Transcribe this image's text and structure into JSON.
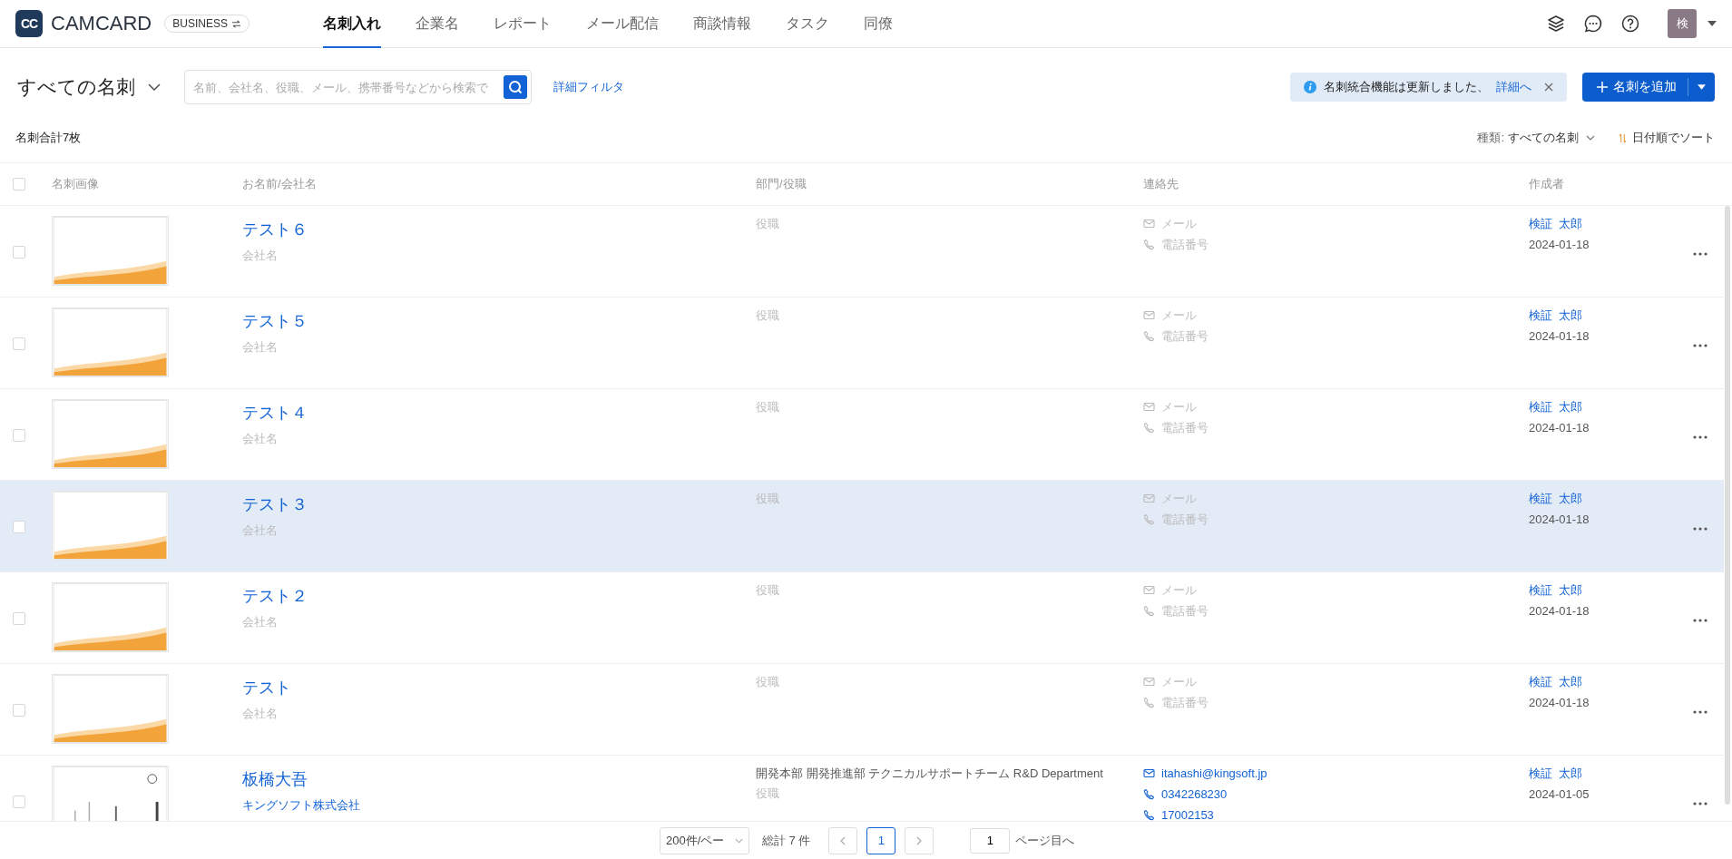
{
  "topbar": {
    "logo_mark": "CC",
    "brand": "CAMCARD",
    "edition": "BUSINESS",
    "nav": [
      {
        "label": "名刺入れ",
        "selected": true
      },
      {
        "label": "企業名",
        "selected": false
      },
      {
        "label": "レポート",
        "selected": false
      },
      {
        "label": "メール配信",
        "selected": false
      },
      {
        "label": "商談情報",
        "selected": false
      },
      {
        "label": "タスク",
        "selected": false
      },
      {
        "label": "同僚",
        "selected": false
      }
    ],
    "avatar": "検"
  },
  "toolbar": {
    "view_title": "すべての名刺",
    "search": {
      "placeholder": "名前、会社名、役職、メール、携帯番号などから検索で"
    },
    "filter_link": "詳細フィルタ",
    "notice": {
      "text": "名刺統合機能は更新しました、",
      "link": "詳細へ"
    },
    "add_button": "名刺を追加"
  },
  "summary": {
    "count": "名刺合計7枚",
    "type_label": "種類:",
    "type_value": "すべての名刺",
    "sort": "日付順でソート"
  },
  "table": {
    "select_all_checked": false,
    "columns": [
      "名刺画像",
      "お名前/会社名",
      "部門/役職",
      "連絡先",
      "作成者"
    ],
    "rows": [
      {
        "kind": "template",
        "checked": false,
        "highlighted": false,
        "name": "テスト６",
        "company": {
          "text": "会社名",
          "empty": true
        },
        "departments": [],
        "title": {
          "text": "役職",
          "empty": true
        },
        "contacts": [
          {
            "kind": "email",
            "text": "メール",
            "empty": true
          },
          {
            "kind": "phone",
            "text": "電話番号",
            "empty": true
          }
        ],
        "creator": "検証  太郎",
        "date": "2024-01-18"
      },
      {
        "kind": "template",
        "checked": false,
        "highlighted": false,
        "name": "テスト５",
        "company": {
          "text": "会社名",
          "empty": true
        },
        "departments": [],
        "title": {
          "text": "役職",
          "empty": true
        },
        "contacts": [
          {
            "kind": "email",
            "text": "メール",
            "empty": true
          },
          {
            "kind": "phone",
            "text": "電話番号",
            "empty": true
          }
        ],
        "creator": "検証  太郎",
        "date": "2024-01-18"
      },
      {
        "kind": "template",
        "checked": false,
        "highlighted": false,
        "name": "テスト４",
        "company": {
          "text": "会社名",
          "empty": true
        },
        "departments": [],
        "title": {
          "text": "役職",
          "empty": true
        },
        "contacts": [
          {
            "kind": "email",
            "text": "メール",
            "empty": true
          },
          {
            "kind": "phone",
            "text": "電話番号",
            "empty": true
          }
        ],
        "creator": "検証  太郎",
        "date": "2024-01-18"
      },
      {
        "kind": "template",
        "checked": false,
        "highlighted": true,
        "name": "テスト３",
        "company": {
          "text": "会社名",
          "empty": true
        },
        "departments": [],
        "title": {
          "text": "役職",
          "empty": true
        },
        "contacts": [
          {
            "kind": "email",
            "text": "メール",
            "empty": true
          },
          {
            "kind": "phone",
            "text": "電話番号",
            "empty": true
          }
        ],
        "creator": "検証  太郎",
        "date": "2024-01-18"
      },
      {
        "kind": "template",
        "checked": false,
        "highlighted": false,
        "name": "テスト２",
        "company": {
          "text": "会社名",
          "empty": true
        },
        "departments": [],
        "title": {
          "text": "役職",
          "empty": true
        },
        "contacts": [
          {
            "kind": "email",
            "text": "メール",
            "empty": true
          },
          {
            "kind": "phone",
            "text": "電話番号",
            "empty": true
          }
        ],
        "creator": "検証  太郎",
        "date": "2024-01-18"
      },
      {
        "kind": "template",
        "checked": false,
        "highlighted": false,
        "name": "テスト",
        "company": {
          "text": "会社名",
          "empty": true
        },
        "departments": [],
        "title": {
          "text": "役職",
          "empty": true
        },
        "contacts": [
          {
            "kind": "email",
            "text": "メール",
            "empty": true
          },
          {
            "kind": "phone",
            "text": "電話番号",
            "empty": true
          }
        ],
        "creator": "検証  太郎",
        "date": "2024-01-18"
      },
      {
        "kind": "scan",
        "checked": false,
        "highlighted": false,
        "name": "板橋大吾",
        "company": {
          "text": "キングソフト株式会社",
          "empty": false
        },
        "departments": [
          "開発本部",
          "開発推進部",
          "テクニカルサポートチーム",
          "R&D Department"
        ],
        "title": {
          "text": "役職",
          "empty": true
        },
        "contacts": [
          {
            "kind": "email",
            "text": "itahashi@kingsoft.jp",
            "empty": false
          },
          {
            "kind": "phone",
            "text": "0342268230",
            "empty": false
          },
          {
            "kind": "mobile",
            "text": "17002153",
            "empty": false
          }
        ],
        "creator": "検証  太郎",
        "date": "2024-01-05"
      }
    ]
  },
  "pagination": {
    "page_size": "200件/ペー",
    "total": "総計 7 件",
    "pages": [
      {
        "label": "1",
        "selected": true
      }
    ],
    "jump_value": "1",
    "jump_label": "ページ目へ"
  }
}
